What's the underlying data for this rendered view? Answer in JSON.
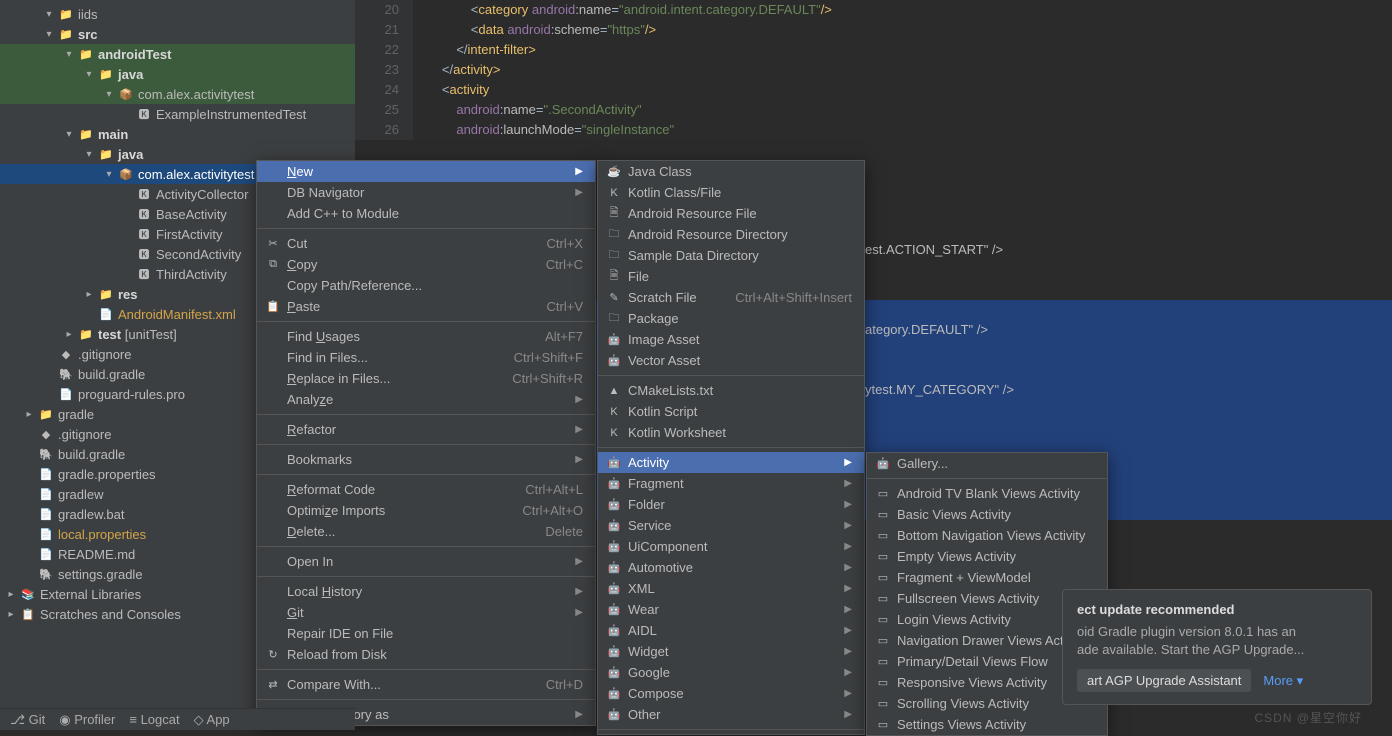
{
  "tree": {
    "iids": "iids",
    "src": "src",
    "androidTest": "androidTest",
    "java_at": "java",
    "pkg_at": "com.alex.activitytest",
    "example": "ExampleInstrumentedTest",
    "main": "main",
    "java_main": "java",
    "pkg_main": "com.alex.activitytest",
    "activityCollector": "ActivityCollector",
    "baseActivity": "BaseActivity",
    "firstActivity": "FirstActivity",
    "secondActivity": "SecondActivity",
    "thirdActivity": "ThirdActivity",
    "res": "res",
    "manifest": "AndroidManifest.xml",
    "test": "test ",
    "unitTest": "[unitTest]",
    "gitignore": ".gitignore",
    "buildGradle": "build.gradle",
    "proguard": "proguard-rules.pro",
    "gradleDir": "gradle",
    "gitignore2": ".gitignore",
    "buildGradle2": "build.gradle",
    "gradleProps": "gradle.properties",
    "gradlew": "gradlew",
    "gradlewBat": "gradlew.bat",
    "localProps": "local.properties",
    "readme": "README.md",
    "settingsGradle": "settings.gradle",
    "extLibs": "External Libraries",
    "scratches": "Scratches and Consoles"
  },
  "code": [
    {
      "n": "20",
      "t": "                <",
      "sp": [
        [
          "tag",
          "category "
        ],
        [
          "attr-ns",
          "android"
        ],
        [
          "op",
          ":"
        ],
        [
          "attr",
          "name"
        ],
        [
          "op",
          "="
        ],
        [
          "str",
          "\"android.intent.category.DEFAULT\""
        ],
        [
          "tag",
          "/>"
        ]
      ]
    },
    {
      "n": "21",
      "t": "                <",
      "sp": [
        [
          "tag",
          "data "
        ],
        [
          "attr-ns",
          "android"
        ],
        [
          "op",
          ":"
        ],
        [
          "attr",
          "scheme"
        ],
        [
          "op",
          "="
        ],
        [
          "str",
          "\"https\""
        ],
        [
          "tag",
          "/>"
        ]
      ]
    },
    {
      "n": "22",
      "t": "            </",
      "sp": [
        [
          "tag",
          "intent-filter>"
        ]
      ]
    },
    {
      "n": "23",
      "t": "        </",
      "sp": [
        [
          "tag",
          "activity>"
        ]
      ]
    },
    {
      "n": "24",
      "t": "        <",
      "sp": [
        [
          "tag",
          "activity"
        ]
      ]
    },
    {
      "n": "25",
      "t": "            ",
      "sp": [
        [
          "attr-ns",
          "android"
        ],
        [
          "op",
          ":"
        ],
        [
          "attr",
          "name"
        ],
        [
          "op",
          "="
        ],
        [
          "str",
          "\".SecondActivity\""
        ]
      ]
    },
    {
      "n": "26",
      "t": "            ",
      "sp": [
        [
          "attr-ns",
          "android"
        ],
        [
          "op",
          ":"
        ],
        [
          "attr",
          "launchMode"
        ],
        [
          "op",
          "="
        ],
        [
          "str",
          "\"singleInstance\""
        ]
      ]
    }
  ],
  "hidden_code": {
    "l1": "est.ACTION_START\" />",
    "l2": "ategory.DEFAULT\" />",
    "l3": "ytest.MY_CATEGORY\" />"
  },
  "menu1": [
    {
      "l": "New",
      "u": "N",
      "sub": true,
      "sel": true
    },
    {
      "l": "DB Navigator",
      "sub": true
    },
    {
      "l": "Add C++ to Module"
    },
    {
      "sep": true
    },
    {
      "l": "Cut",
      "u": "",
      "sc": "Ctrl+X",
      "ic": "cut"
    },
    {
      "l": "Copy",
      "u": "C",
      "sc": "Ctrl+C",
      "ic": "copy"
    },
    {
      "l": "Copy Path/Reference..."
    },
    {
      "l": "Paste",
      "u": "P",
      "sc": "Ctrl+V",
      "ic": "paste"
    },
    {
      "sep": true
    },
    {
      "l": "Find Usages",
      "u": "U",
      "sc": "Alt+F7"
    },
    {
      "l": "Find in Files...",
      "sc": "Ctrl+Shift+F"
    },
    {
      "l": "Replace in Files...",
      "u": "R",
      "sc": "Ctrl+Shift+R"
    },
    {
      "l": "Analyze",
      "u": "z",
      "sub": true
    },
    {
      "sep": true
    },
    {
      "l": "Refactor",
      "u": "R",
      "sub": true
    },
    {
      "sep": true
    },
    {
      "l": "Bookmarks",
      "sub": true
    },
    {
      "sep": true
    },
    {
      "l": "Reformat Code",
      "u": "R",
      "sc": "Ctrl+Alt+L"
    },
    {
      "l": "Optimize Imports",
      "u": "z",
      "sc": "Ctrl+Alt+O"
    },
    {
      "l": "Delete...",
      "u": "D",
      "sc": "Delete"
    },
    {
      "sep": true
    },
    {
      "l": "Open In",
      "sub": true
    },
    {
      "sep": true
    },
    {
      "l": "Local History",
      "u": "H",
      "sub": true
    },
    {
      "l": "Git",
      "u": "G",
      "sub": true
    },
    {
      "l": "Repair IDE on File"
    },
    {
      "l": "Reload from Disk",
      "ic": "reload"
    },
    {
      "sep": true
    },
    {
      "l": "Compare With...",
      "sc": "Ctrl+D",
      "ic": "diff"
    },
    {
      "sep": true
    },
    {
      "l": "Mark Directory as",
      "sub": true
    }
  ],
  "menu2": [
    {
      "l": "Java Class",
      "ic": "java"
    },
    {
      "l": "Kotlin Class/File",
      "ic": "kotlin"
    },
    {
      "l": "Android Resource File",
      "ic": "file"
    },
    {
      "l": "Android Resource Directory",
      "ic": "dir"
    },
    {
      "l": "Sample Data Directory",
      "ic": "dir"
    },
    {
      "l": "File",
      "ic": "file"
    },
    {
      "l": "Scratch File",
      "sc": "Ctrl+Alt+Shift+Insert",
      "ic": "scratch"
    },
    {
      "l": "Package",
      "ic": "dir"
    },
    {
      "l": "Image Asset",
      "ic": "android"
    },
    {
      "l": "Vector Asset",
      "ic": "android"
    },
    {
      "sep": true
    },
    {
      "l": "CMakeLists.txt",
      "ic": "cmake"
    },
    {
      "l": "Kotlin Script",
      "ic": "kotlin"
    },
    {
      "l": "Kotlin Worksheet",
      "ic": "kotlin"
    },
    {
      "sep": true
    },
    {
      "l": "Activity",
      "ic": "android",
      "sub": true,
      "sel": true
    },
    {
      "l": "Fragment",
      "ic": "android",
      "sub": true
    },
    {
      "l": "Folder",
      "ic": "android",
      "sub": true
    },
    {
      "l": "Service",
      "ic": "android",
      "sub": true
    },
    {
      "l": "UiComponent",
      "ic": "android",
      "sub": true
    },
    {
      "l": "Automotive",
      "ic": "android",
      "sub": true
    },
    {
      "l": "XML",
      "ic": "android",
      "sub": true
    },
    {
      "l": "Wear",
      "ic": "android",
      "sub": true
    },
    {
      "l": "AIDL",
      "ic": "android",
      "sub": true
    },
    {
      "l": "Widget",
      "ic": "android",
      "sub": true
    },
    {
      "l": "Google",
      "ic": "android",
      "sub": true
    },
    {
      "l": "Compose",
      "ic": "android",
      "sub": true
    },
    {
      "l": "Other",
      "ic": "android",
      "sub": true
    },
    {
      "sep": true
    }
  ],
  "menu3": [
    {
      "l": "Gallery...",
      "ic": "android"
    },
    {
      "sep": true
    },
    {
      "l": "Android TV Blank Views Activity",
      "ic": "win"
    },
    {
      "l": "Basic Views Activity",
      "ic": "win"
    },
    {
      "l": "Bottom Navigation Views Activity",
      "ic": "win"
    },
    {
      "l": "Empty Views Activity",
      "ic": "win"
    },
    {
      "l": "Fragment + ViewModel",
      "ic": "win"
    },
    {
      "l": "Fullscreen Views Activity",
      "ic": "win"
    },
    {
      "l": "Login Views Activity",
      "ic": "win"
    },
    {
      "l": "Navigation Drawer Views Activity",
      "ic": "win"
    },
    {
      "l": "Primary/Detail Views Flow",
      "ic": "win"
    },
    {
      "l": "Responsive Views Activity",
      "ic": "win"
    },
    {
      "l": "Scrolling Views Activity",
      "ic": "win"
    },
    {
      "l": "Settings Views Activity",
      "ic": "win"
    }
  ],
  "notif": {
    "title": "ect update recommended",
    "full_title_hint": "Android Gradle project update recommended",
    "body1": "oid Gradle plugin version 8.0.1 has an",
    "body2": "ade available. Start the AGP Upgrade...",
    "btn": "art AGP Upgrade Assistant",
    "more": "More"
  },
  "bottombar": {
    "git": "Git",
    "profiler": "Profiler",
    "logcat": "Logcat",
    "app": "App"
  },
  "watermark": "CSDN @星空你好"
}
